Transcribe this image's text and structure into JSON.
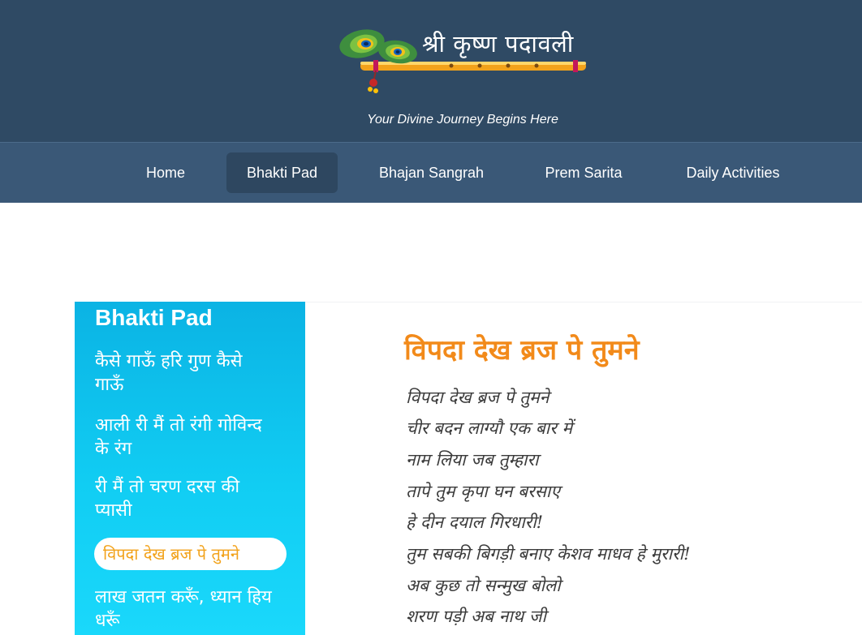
{
  "header": {
    "site_title": "श्री कृष्ण पदावली",
    "tagline": "Your Divine Journey Begins Here"
  },
  "nav": {
    "items": [
      {
        "label": "Home"
      },
      {
        "label": "Bhakti Pad"
      },
      {
        "label": "Bhajan Sangrah"
      },
      {
        "label": "Prem Sarita"
      },
      {
        "label": "Daily Activities"
      }
    ],
    "active": "Bhakti Pad"
  },
  "sidebar": {
    "title": "Bhakti Pad",
    "items": [
      {
        "label": "कैसे गाऊँ हरि गुण कैसे गाऊँ"
      },
      {
        "label": "आली री मैं तो रंगी गोविन्द के रंग"
      },
      {
        "label": "री मैं तो चरण दरस की प्यासी"
      },
      {
        "label": "विपदा देख ब्रज पे तुमने"
      },
      {
        "label": "लाख जतन करूँ, ध्यान हिय धरूँ"
      }
    ],
    "active": "विपदा देख ब्रज पे तुमने"
  },
  "content": {
    "title": "विपदा देख ब्रज पे तुमने",
    "verses": [
      "विपदा देख ब्रज पे तुमने",
      "चीर बदन लाग्यौ एक बार में",
      "नाम लिया जब तुम्हारा",
      "तापे तुम कृपा घन बरसाए",
      "हे दीन दयाल गिरधारी!",
      "तुम सबकी बिगड़ी बनाए केशव माधव हे मुरारी!",
      "अब कुछ तो सन्मुख बोलो",
      "शरण पड़ी अब नाथ जी"
    ]
  },
  "colors": {
    "header_bg": "#2f4a64",
    "nav_bg": "#3a5877",
    "nav_active_bg": "#2e4760",
    "sidebar_bg": "#11cdf3",
    "accent_orange": "#f28a1a",
    "active_item_text": "#f2a21a"
  },
  "icons": {
    "logo": "peacock-feather-flute-icon"
  }
}
